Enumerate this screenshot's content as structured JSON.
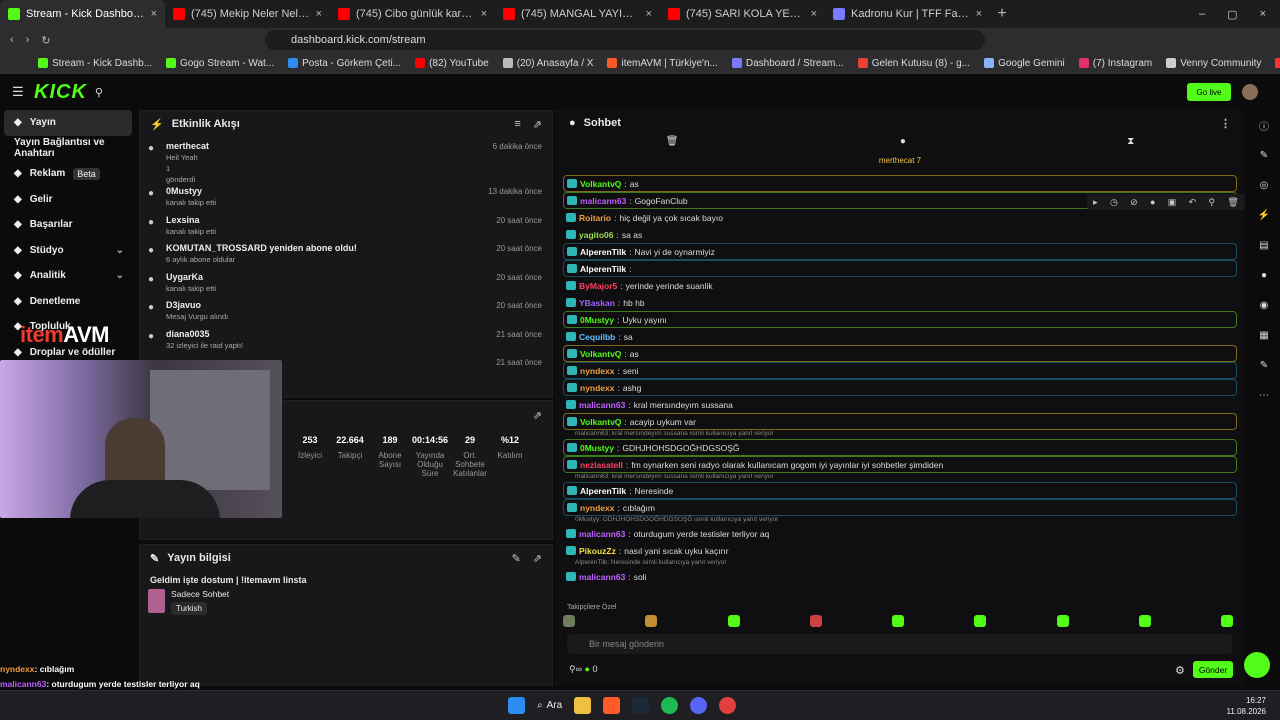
{
  "browser": {
    "tabs": [
      {
        "title": "Stream - Kick Dashboard",
        "color": "#53fc18",
        "active": true
      },
      {
        "title": "(745) Mekip Neler Neler 84.Bölüm C",
        "color": "#ff0000"
      },
      {
        "title": "(745) Cibo günlük karmakarışık #2 -",
        "color": "#ff0000"
      },
      {
        "title": "(745) MANGAL YAYINI ÖNCESİ MEK",
        "color": "#ff0000"
      },
      {
        "title": "(745) SARI KOLA YERİNE PAPATYA Ç",
        "color": "#ff0000"
      },
      {
        "title": "Kadronu Kur | TFF Fantezi Lig",
        "color": "#7a7aff"
      }
    ],
    "url": "dashboard.kick.com/stream",
    "bookmarks": [
      "Stream - Kick Dashb...",
      "Gogo Stream - Wat...",
      "Posta - Görkem Çeti...",
      "(82) YouTube",
      "(20) Anasayfa / X",
      "itemAVM | Türkiye'n...",
      "Dashboard / Stream...",
      "Gelen Kutusu (8) - g...",
      "Google Gemini",
      "(7) Instagram",
      "Venny Community",
      "Lifeinvader - VennyV"
    ]
  },
  "header": {
    "logo": "KICK",
    "go_live": "Go live"
  },
  "sidebar": {
    "items": [
      {
        "label": "Yayın",
        "icon": "broadcast-icon"
      },
      {
        "label": "Yayın Bağlantısı ve Anahtarı",
        "icon": ""
      },
      {
        "label": "Reklam",
        "icon": "ad-icon",
        "badge": "Beta"
      },
      {
        "label": "Gelir",
        "icon": "wallet-icon"
      },
      {
        "label": "Başarılar",
        "icon": "trophy-icon"
      },
      {
        "label": "Stüdyo",
        "icon": "studio-icon"
      },
      {
        "label": "Analitik",
        "icon": "chart-icon"
      },
      {
        "label": "Denetleme",
        "icon": "hammer-icon"
      },
      {
        "label": "Topluluk",
        "icon": "people-icon"
      },
      {
        "label": "Droplar ve ödüller",
        "icon": "gift-icon"
      }
    ]
  },
  "activity": {
    "title": "Etkinlik Akışı",
    "items": [
      {
        "name": "merthecat",
        "sub": "Heil Yeah",
        "extra": "1",
        "extra2": "gönderdi",
        "time": "6 dakika önce"
      },
      {
        "name": "0Mustyy",
        "sub": "kanalı takip etti",
        "time": "13 dakika önce"
      },
      {
        "name": "Lexsina",
        "sub": "kanalı takip etti",
        "time": "20 saat önce"
      },
      {
        "name": "KOMUTAN_TROSSARD yeniden abone oldu!",
        "sub": "6 aylık abone oldular",
        "time": "20 saat önce"
      },
      {
        "name": "UygarKa",
        "sub": "kanalı takip etti",
        "time": "20 saat önce"
      },
      {
        "name": "D3javuo",
        "sub": "Mesaj Vurgu alındı",
        "time": "20 saat önce"
      },
      {
        "name": "diana0035",
        "sub": "32 izleyici ile raid yaptı!",
        "time": "21 saat önce"
      },
      {
        "name": "",
        "sub": "",
        "time": "21 saat önce"
      }
    ]
  },
  "stats": [
    {
      "value": "253",
      "label": "İzleyici"
    },
    {
      "value": "22.664",
      "label": "Takipçi"
    },
    {
      "value": "189",
      "label": "Abone Sayısı"
    },
    {
      "value": "00:14:56",
      "label": "Yayında Olduğu Süre"
    },
    {
      "value": "29",
      "label": "Ort. Sohbete Katılanlar"
    },
    {
      "value": "%12",
      "label": "Katılım"
    }
  ],
  "overlay_logo": {
    "prefix": "item",
    "suffix": "AVM"
  },
  "stream_info": {
    "title": "Yayın bilgisi",
    "stream_title": "Geldim işte dostum | !itemavm linsta",
    "category": "Sadece Sohbet",
    "language": "Turkish"
  },
  "chat": {
    "title": "Sohbet",
    "pinned": "merthecat 7",
    "messages": [
      {
        "user": "VolkantvQ",
        "text": "as",
        "color": "#53fc18",
        "style": "gold"
      },
      {
        "user": "malicann63",
        "text": "GogoFanClub",
        "color": "#c060ff",
        "style": "grn"
      },
      {
        "user": "Roitario",
        "text": "hiç değil ya çok sıcak bayıo",
        "color": "#f0a040",
        "style": ""
      },
      {
        "user": "yagito06",
        "text": "sa as",
        "color": "#9adf50",
        "style": ""
      },
      {
        "user": "AlperenTilk",
        "text": "Navi yi de oynarmiyiz",
        "color": "#ffffff",
        "style": "blue"
      },
      {
        "user": "AlperenTilk",
        "text": "",
        "color": "#ffffff",
        "style": "blue"
      },
      {
        "user": "ByMajor5",
        "text": "yerinde yerinde suanlik",
        "color": "#ff4060",
        "style": ""
      },
      {
        "user": "YBaskan",
        "text": "hb hb",
        "color": "#a060ff",
        "style": ""
      },
      {
        "user": "0Mustyy",
        "text": "Uyku yayını",
        "color": "#53fc18",
        "style": "grn"
      },
      {
        "user": "Cequilbb",
        "text": "sa",
        "color": "#60c0ff",
        "style": ""
      },
      {
        "user": "VolkantvQ",
        "text": "as",
        "color": "#53fc18",
        "style": "gold"
      },
      {
        "user": "nyndexx",
        "text": "seni",
        "color": "#f0a040",
        "style": "blue"
      },
      {
        "user": "nyndexx",
        "text": "ashg",
        "color": "#f0a040",
        "style": "blue"
      },
      {
        "user": "malicann63",
        "text": "kral mersındeyım sussana",
        "color": "#c060ff",
        "style": ""
      },
      {
        "user": "VolkantvQ",
        "text": "acayip uykum var",
        "color": "#53fc18",
        "style": "gold"
      },
      {
        "reply": "malicann63: kral mersındeyım sussana isimli kullanıcıya yanıt veriyor",
        "user": "0Mustyy",
        "text": "GDHJHOHSDGOĞHDGSOŞĞ",
        "color": "#53fc18",
        "style": "grn"
      },
      {
        "user": "nezlasatell",
        "text": "fm oynarken seni radyo olarak kullanıcam gogom iyi yayınlar iyi sohbetler şimdiden",
        "color": "#ff4060",
        "style": "grn"
      },
      {
        "reply": "malicann63: kral mersındeyım sussana isimli kullanıcıya yanıt veriyor",
        "user": "AlperenTilk",
        "text": "Neresinde",
        "color": "#ffffff",
        "style": "blue"
      },
      {
        "user": "nyndexx",
        "text": "cıblağım",
        "color": "#f0a040",
        "style": "blue"
      },
      {
        "reply": "0Mustyy: GDHJHOHSDGOĞHDGSOŞĞ isimli kullanıcıya yanıt veriyor",
        "user": "malicann63",
        "text": "oturdugum yerde testisler terliyor aq",
        "color": "#c060ff",
        "style": ""
      },
      {
        "user": "PikouzZz",
        "text": "nasıl yani sıcak uyku kaçırır",
        "color": "#f0e040",
        "style": ""
      },
      {
        "reply": "AlperenTilk: Neresinde isimli kullanıcıya yanıt veriyor",
        "user": "malicann63",
        "text": "soli",
        "color": "#c060ff",
        "style": ""
      }
    ],
    "followers_only": "Takipçilere Özel",
    "input_placeholder": "Bir mesaj gönderin",
    "send_label": "Gönder",
    "viewer_count": "0"
  },
  "overlay_chat": [
    {
      "user": "nyndexx",
      "text": ": cıblağım"
    },
    {
      "user": "malicann63",
      "text": ": oturdugum yerde testisler terliyor aq"
    },
    {
      "user": "PikouzZz",
      "text": ": nasıl yani sıcak uyku kaçırır"
    },
    {
      "user": "malicann63",
      "text": ": soli"
    }
  ],
  "taskbar": {
    "search": "Ara",
    "time": "16:27",
    "date": "11.08.2026"
  }
}
